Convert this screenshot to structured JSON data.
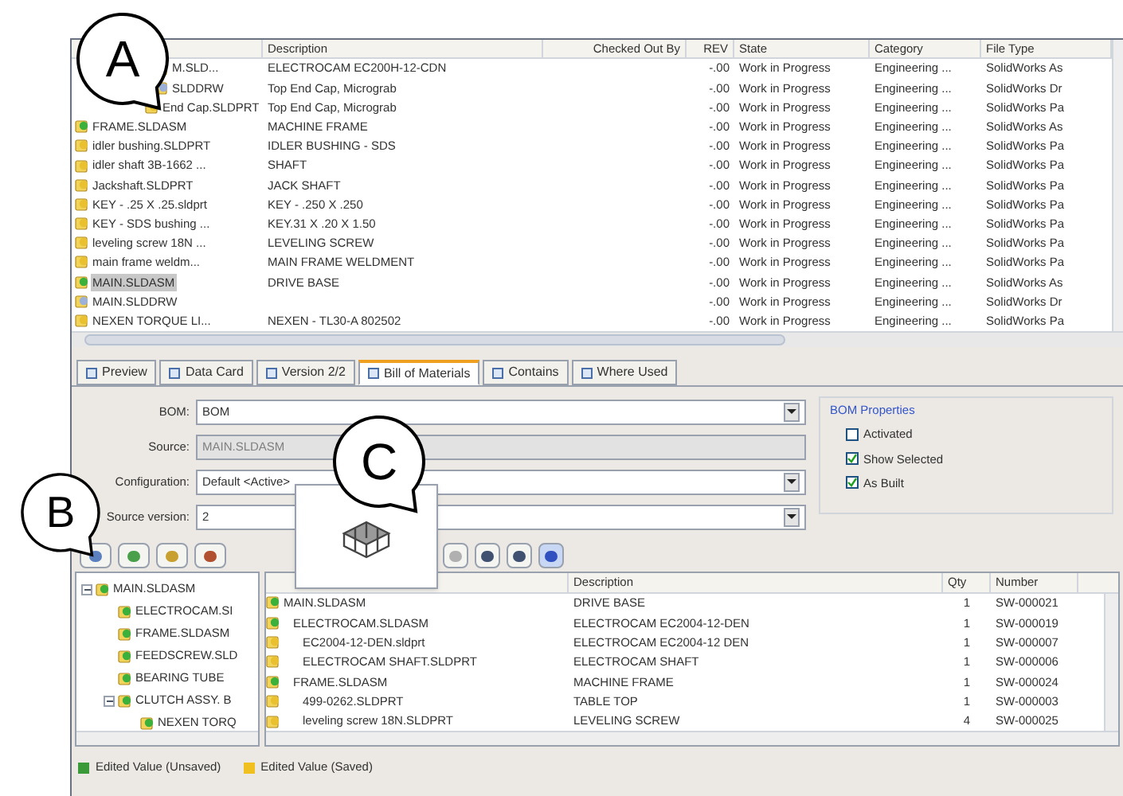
{
  "file_list": {
    "columns": [
      "Description",
      "Checked Out By",
      "REV",
      "State",
      "Category",
      "File Type"
    ],
    "rows": [
      {
        "kind": "assembly",
        "name": "M.SLD...",
        "description": "ELECTROCAM EC200H-12-CDN",
        "rev": "-.00",
        "state": "Work in Progress",
        "category": "Engineering ...",
        "file_type": "SolidWorks As",
        "selected": false
      },
      {
        "kind": "drawing",
        "name": "SLDDRW",
        "description": "Top End Cap, Micrograb",
        "rev": "-.00",
        "state": "Work in Progress",
        "category": "Engineering ...",
        "file_type": "SolidWorks Dr",
        "selected": false
      },
      {
        "kind": "part",
        "name": "End Cap.SLDPRT",
        "description": "Top End Cap, Micrograb",
        "rev": "-.00",
        "state": "Work in Progress",
        "category": "Engineering ...",
        "file_type": "SolidWorks Pa",
        "selected": false
      },
      {
        "kind": "assembly",
        "name": "FRAME.SLDASM",
        "description": "MACHINE FRAME",
        "rev": "-.00",
        "state": "Work in Progress",
        "category": "Engineering ...",
        "file_type": "SolidWorks As",
        "selected": false
      },
      {
        "kind": "part",
        "name": "idler bushing.SLDPRT",
        "description": "IDLER BUSHING - SDS",
        "rev": "-.00",
        "state": "Work in Progress",
        "category": "Engineering ...",
        "file_type": "SolidWorks Pa",
        "selected": false
      },
      {
        "kind": "part",
        "name": "idler shaft 3B-1662 ...",
        "description": "SHAFT",
        "rev": "-.00",
        "state": "Work in Progress",
        "category": "Engineering ...",
        "file_type": "SolidWorks Pa",
        "selected": false
      },
      {
        "kind": "part",
        "name": "Jackshaft.SLDPRT",
        "description": "JACK SHAFT",
        "rev": "-.00",
        "state": "Work in Progress",
        "category": "Engineering ...",
        "file_type": "SolidWorks Pa",
        "selected": false
      },
      {
        "kind": "part",
        "name": "KEY - .25 X .25.sldprt",
        "description": "KEY - .250 X .250",
        "rev": "-.00",
        "state": "Work in Progress",
        "category": "Engineering ...",
        "file_type": "SolidWorks Pa",
        "selected": false
      },
      {
        "kind": "part",
        "name": "KEY - SDS bushing ...",
        "description": "KEY.31 X .20 X 1.50",
        "rev": "-.00",
        "state": "Work in Progress",
        "category": "Engineering ...",
        "file_type": "SolidWorks Pa",
        "selected": false
      },
      {
        "kind": "part",
        "name": "leveling screw 18N ...",
        "description": "LEVELING SCREW",
        "rev": "-.00",
        "state": "Work in Progress",
        "category": "Engineering ...",
        "file_type": "SolidWorks Pa",
        "selected": false
      },
      {
        "kind": "part",
        "name": "main frame weldm...",
        "description": "MAIN FRAME WELDMENT",
        "rev": "-.00",
        "state": "Work in Progress",
        "category": "Engineering ...",
        "file_type": "SolidWorks Pa",
        "selected": false
      },
      {
        "kind": "assembly",
        "name": "MAIN.SLDASM",
        "description": "DRIVE BASE",
        "rev": "-.00",
        "state": "Work in Progress",
        "category": "Engineering ...",
        "file_type": "SolidWorks As",
        "selected": true
      },
      {
        "kind": "drawing",
        "name": "MAIN.SLDDRW",
        "rev": "-.00",
        "state": "Work in Progress",
        "category": "Engineering ...",
        "file_type": "SolidWorks Dr",
        "selected": false
      },
      {
        "kind": "part",
        "name": "NEXEN TORQUE LI...",
        "description": "NEXEN - TL30-A 802502",
        "rev": "-.00",
        "state": "Work in Progress",
        "category": "Engineering ...",
        "file_type": "SolidWorks Pa",
        "selected": false
      }
    ]
  },
  "tabs": [
    {
      "label": "Preview",
      "selected": false
    },
    {
      "label": "Data Card",
      "selected": false
    },
    {
      "label": "Version 2/2",
      "selected": false
    },
    {
      "label": "Bill of Materials",
      "selected": true
    },
    {
      "label": "Contains",
      "selected": false
    },
    {
      "label": "Where Used",
      "selected": false
    }
  ],
  "bom_form": {
    "fields": [
      {
        "label": "BOM:",
        "value": "BOM",
        "kind": "dropdown"
      },
      {
        "label": "Source:",
        "value": "MAIN.SLDASM",
        "kind": "disabled"
      },
      {
        "label": "Configuration:",
        "value": "Default <Active>",
        "kind": "dropdown"
      },
      {
        "label": "Source version:",
        "value": "2",
        "kind": "dropdown"
      }
    ],
    "properties": {
      "title": "BOM Properties",
      "options": [
        {
          "label": "Activated",
          "checked": false
        },
        {
          "label": "Show Selected",
          "checked": true
        },
        {
          "label": "As Built",
          "checked": true
        }
      ]
    }
  },
  "tree": [
    {
      "name": "MAIN.SLDASM",
      "expanded": true,
      "children": [
        {
          "name": "ELECTROCAM.SI"
        },
        {
          "name": "FRAME.SLDASM"
        },
        {
          "name": "FEEDSCREW.SLD"
        },
        {
          "name": "BEARING TUBE"
        },
        {
          "name": "CLUTCH ASSY. B",
          "expanded": true,
          "children": [
            {
              "name": "NEXEN TORQ"
            }
          ]
        }
      ]
    }
  ],
  "bom_grid": {
    "columns": [
      "Description",
      "Qty",
      "Number"
    ],
    "rows": [
      {
        "kind": "assembly",
        "name": "MAIN.SLDASM",
        "description": "DRIVE BASE",
        "qty": "1",
        "number": "SW-000021",
        "children": [
          {
            "kind": "assembly",
            "name": "ELECTROCAM.SLDASM",
            "description": "ELECTROCAM EC2004-12-DEN",
            "qty": "1",
            "number": "SW-000019",
            "children": [
              {
                "kind": "part",
                "name": "EC2004-12-DEN.sldprt",
                "description": "ELECTROCAM EC2004-12 DEN",
                "qty": "1",
                "number": "SW-000007"
              },
              {
                "kind": "part",
                "name": "ELECTROCAM SHAFT.SLDPRT",
                "description": "ELECTROCAM SHAFT",
                "qty": "1",
                "number": "SW-000006"
              }
            ]
          },
          {
            "kind": "assembly",
            "name": "FRAME.SLDASM",
            "description": "MACHINE FRAME",
            "qty": "1",
            "number": "SW-000024",
            "children": [
              {
                "kind": "part",
                "name": "499-0262.SLDPRT",
                "description": "TABLE TOP",
                "qty": "1",
                "number": "SW-000003"
              },
              {
                "kind": "part",
                "name": "leveling screw 18N.SLDPRT",
                "description": "LEVELING SCREW",
                "qty": "4",
                "number": "SW-000025"
              }
            ]
          }
        ]
      }
    ]
  },
  "legend": [
    {
      "label": "Edited Value (Unsaved)",
      "color": "#3a9a3a"
    },
    {
      "label": "Edited Value (Saved)",
      "color": "#f0c020"
    }
  ],
  "callouts": [
    {
      "letter": "A"
    },
    {
      "letter": "B"
    },
    {
      "letter": "C"
    }
  ]
}
